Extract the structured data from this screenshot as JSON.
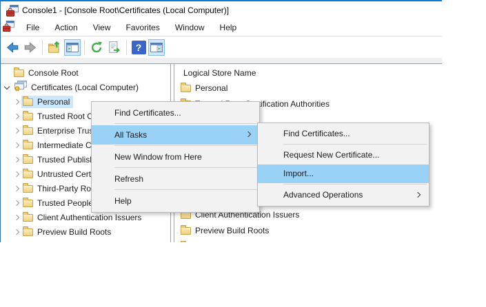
{
  "window": {
    "title": "Console1 - [Console Root\\Certificates (Local Computer)]"
  },
  "menu_bar": {
    "items": [
      {
        "label": "File"
      },
      {
        "label": "Action"
      },
      {
        "label": "View"
      },
      {
        "label": "Favorites"
      },
      {
        "label": "Window"
      },
      {
        "label": "Help"
      }
    ]
  },
  "toolbar": {
    "icons": [
      {
        "name": "back"
      },
      {
        "name": "forward"
      },
      {
        "name": "up-one-level"
      },
      {
        "name": "show-hide-console-tree",
        "toggled": true
      },
      {
        "name": "refresh"
      },
      {
        "name": "export-list"
      },
      {
        "name": "help"
      },
      {
        "name": "show-hide-action-pane",
        "toggled": true
      }
    ]
  },
  "tree": {
    "items": [
      {
        "label": "Console Root",
        "icon": "folder",
        "expander": "none",
        "level": 0
      },
      {
        "label": "Certificates (Local Computer)",
        "icon": "certificates",
        "expander": "expanded",
        "level": 0
      },
      {
        "label": "Personal",
        "icon": "folder",
        "expander": "collapsed",
        "level": 1,
        "selected": true
      },
      {
        "label": "Trusted Root Certification Authorities",
        "icon": "folder",
        "expander": "collapsed",
        "level": 1
      },
      {
        "label": "Enterprise Trust",
        "icon": "folder",
        "expander": "collapsed",
        "level": 1
      },
      {
        "label": "Intermediate Certification Authorities",
        "icon": "folder",
        "expander": "collapsed",
        "level": 1
      },
      {
        "label": "Trusted Publishers",
        "icon": "folder",
        "expander": "collapsed",
        "level": 1
      },
      {
        "label": "Untrusted Certificates",
        "icon": "folder",
        "expander": "collapsed",
        "level": 1
      },
      {
        "label": "Third-Party Root Certification Authorities",
        "icon": "folder",
        "expander": "collapsed",
        "level": 1
      },
      {
        "label": "Trusted People",
        "icon": "folder",
        "expander": "collapsed",
        "level": 1
      },
      {
        "label": "Client Authentication Issuers",
        "icon": "folder",
        "expander": "collapsed",
        "level": 1
      },
      {
        "label": "Preview Build Roots",
        "icon": "folder",
        "expander": "collapsed",
        "level": 1
      }
    ]
  },
  "list": {
    "header": "Logical Store Name",
    "items": [
      {
        "label": "Personal"
      },
      {
        "label": "Trusted Root Certification Authorities"
      },
      {
        "label": "Client Authentication Issuers"
      },
      {
        "label": "Preview Build Roots"
      },
      {
        "label": ""
      }
    ]
  },
  "context_menu": {
    "items": [
      {
        "label": "Find Certificates..."
      },
      {
        "label": "All Tasks",
        "has_submenu": true,
        "highlighted": true
      },
      {
        "label": "New Window from Here"
      },
      {
        "label": "Refresh"
      },
      {
        "label": "Help"
      }
    ]
  },
  "submenu": {
    "items": [
      {
        "label": "Find Certificates..."
      },
      {
        "label": "Request New Certificate..."
      },
      {
        "label": "Import...",
        "highlighted": true
      },
      {
        "label": "Advanced Operations",
        "has_submenu": true
      }
    ]
  },
  "colors": {
    "accent": "#0078d7",
    "menu_highlight": "#99d1f7",
    "tree_selection": "#cce8ff",
    "folder": "#f0d27d",
    "menu_background": "#f2f2f2"
  }
}
